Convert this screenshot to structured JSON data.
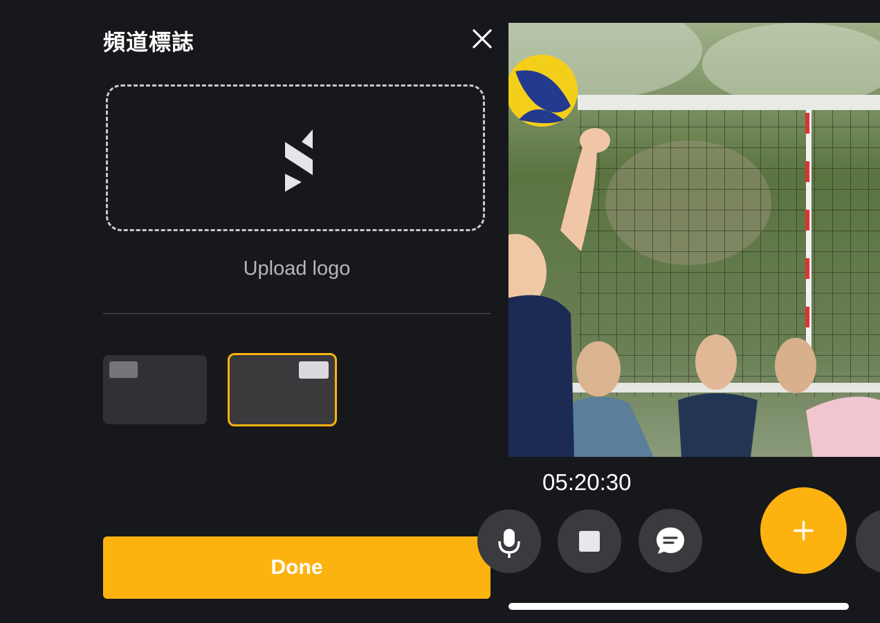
{
  "dialog": {
    "title": "頻道標誌",
    "upload_label": "Upload logo",
    "done_label": "Done",
    "close_icon": "close-icon",
    "logo_icon": "channel-logo-icon",
    "position_options": [
      "top-left",
      "top-right"
    ],
    "selected_position": "top-right",
    "accent_color": "#fdb30f"
  },
  "stream": {
    "timer": "05:20:30",
    "controls": [
      "microphone-icon",
      "stop-icon",
      "chat-icon",
      "plus-icon"
    ]
  }
}
